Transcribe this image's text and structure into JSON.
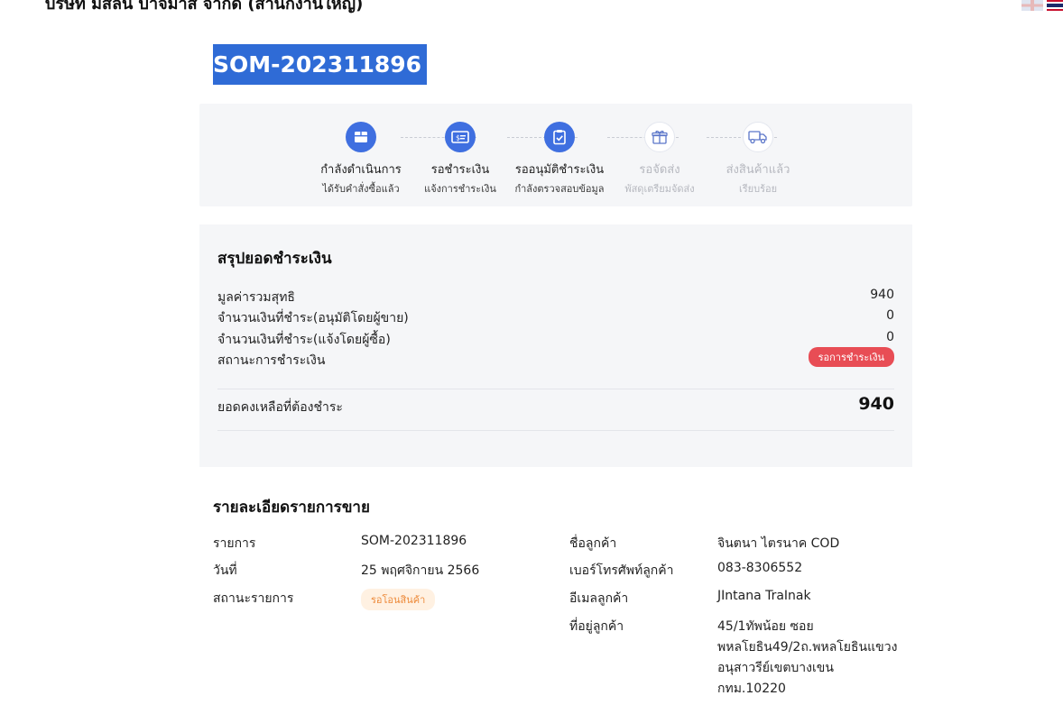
{
  "header": {
    "company": "บริษัท มิสลีน บาจิมาส จำกัด (สำนักงานใหญ่)",
    "languages": [
      "English",
      "ไทย"
    ]
  },
  "order": {
    "id": "SOM-202311896"
  },
  "progress": {
    "current_step": 3,
    "steps": [
      {
        "title": "กำลังดำเนินการ",
        "subtitle": "ได้รับคำสั่งซื้อแล้ว",
        "icon": "box-icon",
        "state": "active"
      },
      {
        "title": "รอชำระเงิน",
        "subtitle": "แจ้งการชำระเงิน",
        "icon": "money-card-icon",
        "state": "active"
      },
      {
        "title": "รออนุมัติชำระเงิน",
        "subtitle": "กำลังตรวจสอบข้อมูล",
        "icon": "clipboard-check-icon",
        "state": "active"
      },
      {
        "title": "รอจัดส่ง",
        "subtitle": "พัสดุเตรียมจัดส่ง",
        "icon": "gift-box-icon",
        "state": "inactive"
      },
      {
        "title": "ส่งสินค้าแล้ว",
        "subtitle": "เรียบร้อย",
        "icon": "truck-icon",
        "state": "inactive"
      }
    ]
  },
  "summary": {
    "title": "สรุปยอดชำระเงิน",
    "rows": [
      {
        "label": "มูลค่ารวมสุทธิ",
        "value": "940"
      },
      {
        "label": "จำนวนเงินที่ชำระ(อนุมัติโดยผู้ขาย)",
        "value": "0"
      },
      {
        "label": "จำนวนเงินที่ชำระ(แจ้งโดยผู้ซื้อ)",
        "value": "0"
      }
    ],
    "status_label": "สถานะการชำระเงิน",
    "status_badge": "รอการชำระเงิน",
    "balance_label": "ยอดคงเหลือที่ต้องชำระ",
    "balance_value": "940"
  },
  "details": {
    "title": "รายละเอียดรายการขาย",
    "left": [
      {
        "label": "รายการ",
        "value": "SOM-202311896"
      },
      {
        "label": "วันที่",
        "value": "25 พฤศจิกายน 2566"
      },
      {
        "label": "สถานะรายการ",
        "badge": "รอโอนสินค้า"
      }
    ],
    "right": [
      {
        "label": "ชื่อลูกค้า",
        "value": "จินตนา ไตรนาค COD"
      },
      {
        "label": "เบอร์โทรศัพท์ลูกค้า",
        "value": "083-8306552"
      },
      {
        "label": "อีเมลลูกค้า",
        "value": "JIntana TraInak"
      },
      {
        "label": "ที่อยู่ลูกค้า",
        "value_lines": [
          "45/1ทัพน้อย ซอย",
          "พหลโยธิน49/2ถ.พหลโยธินแขวง",
          "อนุสาวรีย์เขตบางเขน",
          "กทม.10220"
        ]
      }
    ]
  },
  "colors": {
    "accent": "#3f6fe0",
    "selection": "#2f6bd6",
    "panel": "#f5f6f8",
    "badge_red": "#e84d55",
    "badge_orange_bg": "#fff1e2",
    "badge_orange_text": "#ed8a3a"
  }
}
